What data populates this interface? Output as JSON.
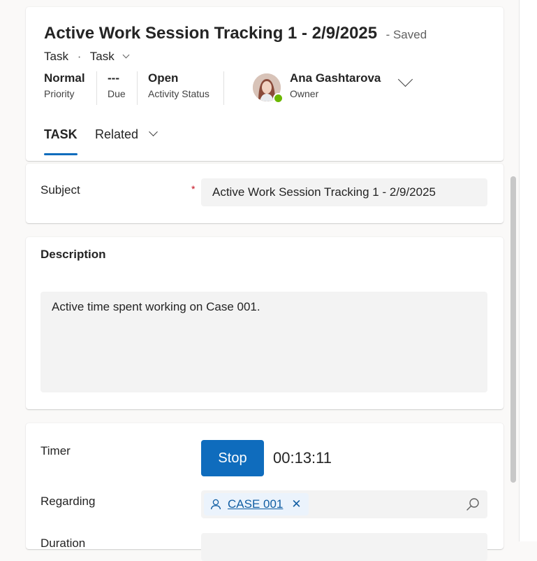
{
  "header": {
    "title": "Active Work Session Tracking 1 - 2/9/2025",
    "save_status": "- Saved",
    "entity_type": "Task",
    "form_selector": "Task",
    "fields": [
      {
        "value": "Normal",
        "label": "Priority"
      },
      {
        "value": "---",
        "label": "Due"
      },
      {
        "value": "Open",
        "label": "Activity Status"
      }
    ],
    "owner": {
      "name": "Ana Gashtarova",
      "label": "Owner"
    },
    "presence_color": "#6bb700"
  },
  "tabs": [
    {
      "label": "TASK",
      "selected": true
    },
    {
      "label": "Related",
      "selected": false
    }
  ],
  "subject": {
    "label": "Subject",
    "required_marker": "*",
    "value": "Active Work Session Tracking 1 - 2/9/2025"
  },
  "description": {
    "title": "Description",
    "value": "Active time spent working on Case 001."
  },
  "timer_section": {
    "timer_label": "Timer",
    "stop_label": "Stop",
    "timer_value": "00:13:11",
    "regarding_label": "Regarding",
    "regarding_value": "CASE 001",
    "duration_label": "Duration"
  },
  "colors": {
    "accent": "#0f6cbd",
    "link": "#115ea3",
    "required": "#c50f1f"
  }
}
